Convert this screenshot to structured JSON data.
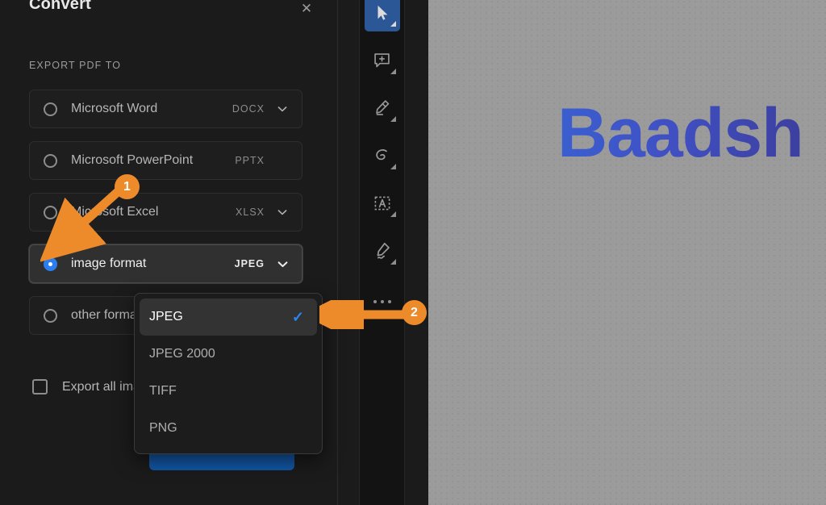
{
  "panel": {
    "title": "Convert",
    "close_icon": "close-icon",
    "section_label": "EXPORT PDF TO",
    "options": [
      {
        "label": "Microsoft Word",
        "ext": "DOCX",
        "has_chevron": true,
        "selected": false
      },
      {
        "label": "Microsoft PowerPoint",
        "ext": "PPTX",
        "has_chevron": false,
        "selected": false
      },
      {
        "label": "Microsoft Excel",
        "ext": "XLSX",
        "has_chevron": true,
        "selected": false
      },
      {
        "label": "image format",
        "ext": "JPEG",
        "has_chevron": true,
        "selected": true
      },
      {
        "label": "other format",
        "ext": "",
        "has_chevron": false,
        "selected": false
      }
    ],
    "export_all_label": "Export all images",
    "primary_button_label": ""
  },
  "dropdown": {
    "items": [
      {
        "label": "JPEG",
        "checked": true
      },
      {
        "label": "JPEG 2000",
        "checked": false
      },
      {
        "label": "TIFF",
        "checked": false
      },
      {
        "label": "PNG",
        "checked": false
      }
    ],
    "check_glyph": "✓"
  },
  "toolbar": {
    "tools": [
      {
        "name": "select-tool",
        "active": true
      },
      {
        "name": "comment-tool",
        "active": false
      },
      {
        "name": "highlight-tool",
        "active": false
      },
      {
        "name": "draw-tool",
        "active": false
      },
      {
        "name": "text-box-tool",
        "active": false
      },
      {
        "name": "sign-tool",
        "active": false
      }
    ],
    "more_label": "···"
  },
  "document": {
    "headline": "Baadsh"
  },
  "annotations": [
    {
      "id": "1",
      "label": "1"
    },
    {
      "id": "2",
      "label": "2"
    }
  ],
  "colors": {
    "accent_blue": "#2a7ef0",
    "callout_orange": "#ed8b2b",
    "panel_bg": "#1b1b1b",
    "canvas_bg": "#9b9b9b",
    "primary_button": "#1257a5"
  }
}
